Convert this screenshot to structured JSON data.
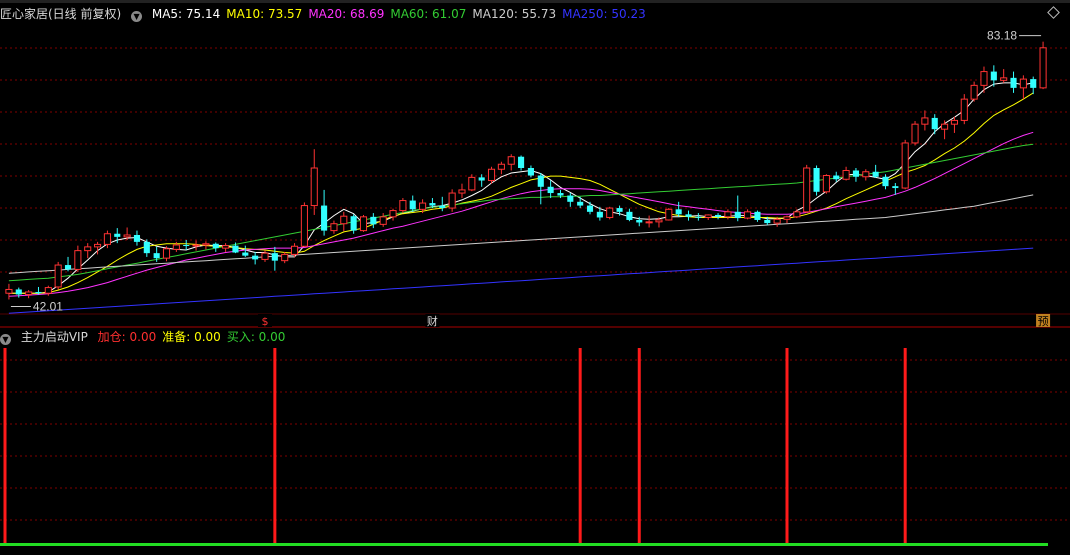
{
  "title": "匠心家居(日线 前复权)",
  "ma_legend": [
    {
      "label": "MA5: 75.14",
      "color": "#ffffff"
    },
    {
      "label": "MA10: 73.57",
      "color": "#ffff00"
    },
    {
      "label": "MA20: 68.69",
      "color": "#ff33ff"
    },
    {
      "label": "MA60: 61.07",
      "color": "#33cc33"
    },
    {
      "label": "MA120: 55.73",
      "color": "#cccccc"
    },
    {
      "label": "MA250: 50.23",
      "color": "#3333ff"
    }
  ],
  "indicator": {
    "name": "主力启动VIP",
    "items": [
      {
        "label": "加仓: 0.00",
        "color": "#ff3030"
      },
      {
        "label": "准备: 0.00",
        "color": "#ffff00"
      },
      {
        "label": "买入: 0.00",
        "color": "#33cc33"
      }
    ]
  },
  "markers": {
    "s": "$",
    "cai": "财",
    "yu": "预"
  },
  "colors": {
    "up": "#ff3333",
    "down": "#33ffff",
    "grid": "#800000",
    "bg": "#000000"
  },
  "chart_data": {
    "type": "candlestick",
    "price_max_label": "83.18",
    "price_min_label": "42.01",
    "ylim": [
      40,
      86
    ],
    "candles": [
      [
        43,
        44.5,
        42.0,
        43.6
      ],
      [
        43.6,
        43.9,
        42.3,
        42.8
      ],
      [
        42.8,
        43.5,
        42.2,
        43.2
      ],
      [
        43.2,
        44.0,
        42.8,
        43.0
      ],
      [
        43,
        44.2,
        42.6,
        43.9
      ],
      [
        44,
        48,
        43.6,
        47.5
      ],
      [
        47.5,
        48.8,
        46.5,
        46.8
      ],
      [
        46.8,
        50.6,
        46.4,
        49.8
      ],
      [
        49.8,
        51.0,
        48.6,
        50.4
      ],
      [
        50.4,
        51.2,
        49.2,
        50.8
      ],
      [
        50.8,
        53.0,
        50.2,
        52.5
      ],
      [
        52.5,
        53.4,
        51.0,
        52.0
      ],
      [
        52,
        53.5,
        51.5,
        52.3
      ],
      [
        52.3,
        53.0,
        50.6,
        51.2
      ],
      [
        51.2,
        51.6,
        48.8,
        49.4
      ],
      [
        49.4,
        50.4,
        48.0,
        48.6
      ],
      [
        48.6,
        50.5,
        48.1,
        50.1
      ],
      [
        50,
        51.2,
        49.6,
        50.7
      ],
      [
        50.7,
        51.5,
        49.9,
        50.6
      ],
      [
        50.6,
        51.4,
        49.8,
        50.7
      ],
      [
        50.7,
        51.3,
        50.0,
        50.9
      ],
      [
        50.9,
        51.1,
        49.6,
        50.2
      ],
      [
        50.2,
        51.0,
        49.6,
        50.6
      ],
      [
        50.6,
        51.1,
        49.4,
        49.5
      ],
      [
        49.5,
        50.6,
        48.8,
        49.0
      ],
      [
        49,
        49.6,
        47.6,
        48.4
      ],
      [
        48.4,
        49.8,
        48.0,
        49.4
      ],
      [
        49.4,
        50.4,
        46.6,
        48.2
      ],
      [
        48.2,
        49.6,
        47.8,
        49.2
      ],
      [
        49.2,
        51.0,
        48.8,
        50.5
      ],
      [
        50.5,
        57.5,
        50.4,
        57.0
      ],
      [
        57,
        66.0,
        55.5,
        63.0
      ],
      [
        57,
        59.5,
        52.2,
        53.0
      ],
      [
        53,
        54.6,
        52.5,
        54.1
      ],
      [
        54.1,
        56.0,
        52.9,
        55.3
      ],
      [
        55.3,
        55.6,
        52.5,
        53.0
      ],
      [
        53,
        55.5,
        52.8,
        55.2
      ],
      [
        55.2,
        55.8,
        53.4,
        54.0
      ],
      [
        54,
        55.8,
        53.6,
        55.2
      ],
      [
        55.2,
        56.5,
        54.6,
        56.2
      ],
      [
        56.2,
        58.2,
        55.8,
        57.8
      ],
      [
        57.8,
        58.6,
        56.0,
        56.4
      ],
      [
        56.4,
        58.0,
        55.8,
        57.4
      ],
      [
        57.4,
        58.2,
        56.6,
        57.0
      ],
      [
        57,
        58.4,
        56.1,
        56.6
      ],
      [
        56.6,
        59.6,
        56.0,
        59.0
      ],
      [
        59,
        60.5,
        58.2,
        59.5
      ],
      [
        59.5,
        62.0,
        59.3,
        61.5
      ],
      [
        61.5,
        62.0,
        60.0,
        61.0
      ],
      [
        61,
        63.2,
        60.5,
        62.8
      ],
      [
        62.8,
        64.0,
        62.0,
        63.6
      ],
      [
        63.6,
        65.2,
        62.6,
        64.8
      ],
      [
        64.8,
        65.0,
        62.6,
        63.0
      ],
      [
        63,
        63.4,
        61.5,
        61.8
      ],
      [
        61.8,
        62.2,
        57.2,
        60.0
      ],
      [
        60,
        61.0,
        58.2,
        59.0
      ],
      [
        59,
        59.5,
        58.2,
        58.6
      ],
      [
        58.6,
        59.0,
        56.8,
        57.6
      ],
      [
        57.6,
        58.4,
        56.6,
        57.0
      ],
      [
        57,
        57.6,
        55.6,
        56.0
      ],
      [
        56,
        56.8,
        54.6,
        55.1
      ],
      [
        55.1,
        56.8,
        54.8,
        56.6
      ],
      [
        56.6,
        57.0,
        55.4,
        56.0
      ],
      [
        56,
        56.5,
        54.5,
        54.7
      ],
      [
        54.7,
        55.2,
        53.7,
        54.3
      ],
      [
        54.3,
        55.4,
        53.5,
        54.4
      ],
      [
        54.4,
        55.1,
        53.5,
        54.7
      ],
      [
        54.7,
        56.6,
        54.6,
        56.4
      ],
      [
        56.4,
        57.6,
        55.2,
        55.6
      ],
      [
        55.6,
        56.2,
        54.6,
        55.2
      ],
      [
        55.2,
        55.8,
        54.6,
        55.1
      ],
      [
        55.1,
        55.6,
        54.7,
        55.5
      ],
      [
        55.5,
        55.8,
        54.8,
        55.2
      ],
      [
        55.2,
        56.4,
        54.8,
        56.0
      ],
      [
        56,
        58.6,
        54.5,
        55.0
      ],
      [
        55,
        56.4,
        54.8,
        56.0
      ],
      [
        56,
        56.2,
        54.4,
        54.7
      ],
      [
        54.7,
        55.2,
        53.9,
        54.2
      ],
      [
        54.2,
        55.2,
        53.6,
        54.8
      ],
      [
        54.8,
        55.4,
        54.2,
        55.2
      ],
      [
        55.2,
        56.4,
        55.0,
        56.0
      ],
      [
        56,
        63.5,
        55.8,
        63.0
      ],
      [
        63,
        63.4,
        58.6,
        59.2
      ],
      [
        59.2,
        62.0,
        58.9,
        61.8
      ],
      [
        61.8,
        62.4,
        60.8,
        61.2
      ],
      [
        61.2,
        63.2,
        61.0,
        62.6
      ],
      [
        62.6,
        63.0,
        60.8,
        61.6
      ],
      [
        61.6,
        62.8,
        61.0,
        62.4
      ],
      [
        62.4,
        63.5,
        61.4,
        61.6
      ],
      [
        61.6,
        62.0,
        59.6,
        60.1
      ],
      [
        60.1,
        60.6,
        58.7,
        59.8
      ],
      [
        59.8,
        67.5,
        59.6,
        67.0
      ],
      [
        67,
        70.5,
        66.6,
        70.0
      ],
      [
        70,
        72.2,
        69.0,
        71.0
      ],
      [
        71,
        71.6,
        68.4,
        69.2
      ],
      [
        69.2,
        70.6,
        67.6,
        70.0
      ],
      [
        70,
        71.2,
        68.6,
        70.6
      ],
      [
        70.6,
        74.8,
        70.0,
        74.0
      ],
      [
        74,
        76.8,
        73.6,
        76.2
      ],
      [
        76.2,
        79.2,
        75.0,
        78.4
      ],
      [
        78.4,
        79.4,
        76.0,
        77.0
      ],
      [
        77,
        78.8,
        76.6,
        77.4
      ],
      [
        77.4,
        78.4,
        75.0,
        75.8
      ],
      [
        75.8,
        77.8,
        74.0,
        77.2
      ],
      [
        77.2,
        77.6,
        74.8,
        75.8
      ],
      [
        75.8,
        83.18,
        75.6,
        82.2
      ]
    ],
    "ma_lines": [
      {
        "name": "MA5",
        "color": "#ffffff",
        "start": 0,
        "values": [
          43,
          43,
          43,
          43,
          43.2,
          44.2,
          45.4,
          46.9,
          48.3,
          49.8,
          50.9,
          51.5,
          51.8,
          51.9,
          51.2,
          50.5,
          50.2,
          50.0,
          49.9,
          50.4,
          50.7,
          50.6,
          50.6,
          50.3,
          49.9,
          49.5,
          49.5,
          49.1,
          48.8,
          48.8,
          50.6,
          53.1,
          54.2,
          55.4,
          56.4,
          55.7,
          54.1,
          54.3,
          54.5,
          55.2,
          55.8,
          56.1,
          56.5,
          56.8,
          57.0,
          57.4,
          57.9,
          58.6,
          59.4,
          60.6,
          61.6,
          62.2,
          62.4,
          62.6,
          62.1,
          61.1,
          59.9,
          59.1,
          58.2,
          57.3,
          56.5,
          56.0,
          55.7,
          55.2,
          54.9,
          54.8,
          54.9,
          55.2,
          55.2,
          55.3,
          55.4,
          55.2,
          55.2,
          55.3,
          55.4,
          55.4,
          55.2,
          54.9,
          54.9,
          55.0,
          56.2,
          57.0,
          58.2,
          59.3,
          60.7,
          61.9,
          62.0,
          61.8,
          61.5,
          61.2,
          62.1,
          63.8,
          65.6,
          66.9,
          68.8,
          70.1,
          71.1,
          72.2,
          74.0,
          75.5,
          76.4,
          76.6,
          76.6,
          76.3,
          76.6
        ]
      },
      {
        "name": "MA10",
        "color": "#ffff00",
        "start": 0,
        "values": [
          43,
          43,
          43,
          43,
          43.1,
          43.5,
          44.0,
          44.7,
          45.5,
          46.4,
          47.3,
          48.3,
          49.2,
          50.0,
          50.5,
          50.7,
          50.9,
          50.9,
          50.9,
          50.8,
          50.6,
          50.5,
          50.4,
          50.3,
          50.1,
          50.0,
          49.9,
          49.7,
          49.5,
          49.4,
          49.7,
          50.6,
          51.4,
          52.1,
          52.8,
          53.1,
          53.4,
          54.0,
          54.7,
          55.3,
          55.7,
          55.9,
          56.1,
          56.4,
          56.6,
          57.0,
          57.4,
          57.7,
          58.0,
          58.5,
          59.2,
          59.9,
          60.5,
          61.1,
          61.4,
          61.7,
          61.7,
          61.5,
          61.3,
          61.0,
          60.4,
          59.6,
          58.8,
          58.0,
          57.2,
          56.6,
          56.0,
          55.7,
          55.4,
          55.2,
          55.1,
          55.1,
          55.1,
          55.1,
          55.1,
          55.1,
          55.1,
          55.1,
          55.0,
          55.0,
          55.2,
          55.6,
          56.1,
          56.6,
          57.3,
          58.1,
          58.8,
          59.5,
          60.2,
          60.9,
          61.6,
          62.3,
          62.8,
          63.4,
          64.3,
          65.3,
          66.2,
          67.3,
          68.6,
          70.1,
          71.4,
          72.3,
          73.1,
          74.0,
          75.0
        ]
      },
      {
        "name": "MA20",
        "color": "#ff33ff",
        "start": 0,
        "values": [
          42.5,
          42.6,
          42.7,
          42.8,
          42.9,
          43.1,
          43.3,
          43.6,
          43.9,
          44.3,
          44.7,
          45.2,
          45.7,
          46.2,
          46.7,
          47.1,
          47.5,
          47.9,
          48.3,
          48.6,
          48.9,
          49.2,
          49.5,
          49.7,
          49.9,
          50.0,
          50.1,
          50.2,
          50.2,
          50.2,
          50.3,
          50.6,
          50.9,
          51.2,
          51.5,
          51.8,
          52.2,
          52.6,
          53.0,
          53.4,
          53.7,
          54.1,
          54.5,
          54.9,
          55.3,
          55.7,
          56.1,
          56.6,
          57.1,
          57.6,
          58.1,
          58.5,
          58.9,
          59.2,
          59.4,
          59.6,
          59.7,
          59.7,
          59.7,
          59.6,
          59.4,
          59.1,
          58.8,
          58.5,
          58.2,
          57.9,
          57.6,
          57.3,
          57.0,
          56.8,
          56.6,
          56.4,
          56.2,
          56.0,
          55.9,
          55.8,
          55.7,
          55.6,
          55.6,
          55.6,
          55.7,
          55.9,
          56.2,
          56.5,
          56.8,
          57.1,
          57.4,
          57.7,
          58.0,
          58.3,
          58.8,
          59.3,
          59.9,
          60.6,
          61.3,
          62.1,
          62.9,
          63.7,
          64.5,
          65.3,
          66.1,
          66.9,
          67.6,
          68.2,
          68.7
        ]
      },
      {
        "name": "MA60",
        "color": "#33cc33",
        "start": 0,
        "values": [
          45.0,
          45.1,
          45.2,
          45.3,
          45.4,
          45.6,
          45.8,
          46.0,
          46.3,
          46.6,
          46.9,
          47.2,
          47.5,
          47.8,
          48.1,
          48.4,
          48.7,
          49.0,
          49.3,
          49.6,
          49.9,
          50.2,
          50.5,
          50.8,
          51.1,
          51.4,
          51.7,
          52.0,
          52.3,
          52.6,
          52.9,
          53.2,
          53.5,
          53.8,
          54.1,
          54.4,
          54.7,
          55.0,
          55.3,
          55.6,
          55.9,
          56.2,
          56.5,
          56.7,
          56.9,
          57.1,
          57.3,
          57.5,
          57.7,
          57.9,
          58.0,
          58.1,
          58.2,
          58.3,
          58.3,
          58.4,
          58.4,
          58.5,
          58.5,
          58.6,
          58.6,
          58.7,
          58.8,
          58.9,
          59.0,
          59.1,
          59.2,
          59.3,
          59.4,
          59.5,
          59.6,
          59.7,
          59.8,
          59.9,
          60.0,
          60.1,
          60.2,
          60.3,
          60.4,
          60.5,
          60.6,
          60.8,
          61.0,
          61.2,
          61.4,
          61.6,
          61.8,
          62.0,
          62.2,
          62.4,
          62.7,
          63.0,
          63.3,
          63.6,
          63.9,
          64.2,
          64.5,
          64.8,
          65.1,
          65.4,
          65.7,
          66.0,
          66.3,
          66.6,
          66.8
        ]
      },
      {
        "name": "MA120",
        "color": "#cccccc",
        "start": 0,
        "values": [
          46.2,
          46.3,
          46.4,
          46.5,
          46.6,
          46.7,
          46.8,
          46.9,
          47.0,
          47.1,
          47.2,
          47.3,
          47.4,
          47.5,
          47.6,
          47.7,
          47.8,
          47.9,
          48.0,
          48.1,
          48.2,
          48.3,
          48.4,
          48.5,
          48.6,
          48.7,
          48.8,
          48.9,
          49.0,
          49.1,
          49.2,
          49.3,
          49.4,
          49.5,
          49.6,
          49.7,
          49.8,
          49.9,
          50.0,
          50.1,
          50.2,
          50.3,
          50.4,
          50.5,
          50.6,
          50.7,
          50.8,
          50.9,
          51.0,
          51.1,
          51.2,
          51.3,
          51.4,
          51.5,
          51.6,
          51.7,
          51.8,
          51.9,
          52.0,
          52.1,
          52.2,
          52.3,
          52.4,
          52.5,
          52.6,
          52.7,
          52.8,
          52.9,
          53.0,
          53.1,
          53.2,
          53.3,
          53.4,
          53.5,
          53.6,
          53.7,
          53.8,
          53.9,
          54.0,
          54.1,
          54.2,
          54.3,
          54.4,
          54.5,
          54.6,
          54.7,
          54.8,
          54.9,
          55.0,
          55.1,
          55.3,
          55.5,
          55.7,
          55.9,
          56.1,
          56.3,
          56.5,
          56.7,
          56.9,
          57.2,
          57.5,
          57.8,
          58.1,
          58.4,
          58.7
        ]
      },
      {
        "name": "MA250",
        "color": "#3333ff",
        "start": 0,
        "values": [
          39.8,
          39.9,
          40.0,
          40.1,
          40.2,
          40.3,
          40.4,
          40.5,
          40.6,
          40.7,
          40.8,
          40.9,
          41.0,
          41.1,
          41.2,
          41.3,
          41.4,
          41.5,
          41.6,
          41.7,
          41.8,
          41.9,
          42.0,
          42.1,
          42.2,
          42.3,
          42.4,
          42.5,
          42.6,
          42.7,
          42.8,
          42.9,
          43.0,
          43.1,
          43.2,
          43.3,
          43.4,
          43.5,
          43.6,
          43.7,
          43.8,
          43.9,
          44.0,
          44.1,
          44.2,
          44.3,
          44.4,
          44.5,
          44.6,
          44.7,
          44.8,
          44.9,
          45.0,
          45.1,
          45.2,
          45.3,
          45.4,
          45.5,
          45.6,
          45.7,
          45.8,
          45.9,
          46.0,
          46.1,
          46.2,
          46.3,
          46.4,
          46.5,
          46.6,
          46.7,
          46.8,
          46.9,
          47.0,
          47.1,
          47.2,
          47.3,
          47.4,
          47.5,
          47.6,
          47.7,
          47.8,
          47.9,
          48.0,
          48.1,
          48.2,
          48.3,
          48.4,
          48.5,
          48.6,
          48.7,
          48.8,
          48.9,
          49.0,
          49.1,
          49.2,
          49.3,
          49.4,
          49.5,
          49.6,
          49.7,
          49.8,
          49.9,
          50.0,
          50.1,
          50.2
        ]
      }
    ],
    "signal_bars": [
      0,
      27,
      58,
      64,
      79,
      91
    ],
    "marker_positions": {
      "s": 26,
      "cai": 43,
      "yu": 105
    }
  }
}
